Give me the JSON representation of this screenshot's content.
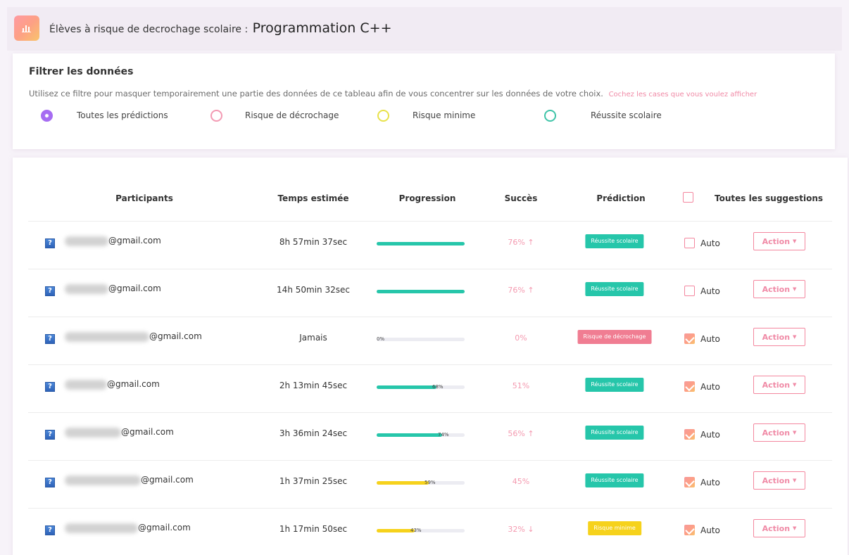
{
  "header": {
    "title_prefix": "Élèves à risque de decrochage scolaire :",
    "course": "Programmation C++",
    "icon": "chart-icon"
  },
  "filter": {
    "title": "Filtrer les données",
    "description": "Utilisez ce filtre pour masquer temporairement une partie des données de ce tableau afin de vous concentrer sur les données de votre choix.",
    "hint": "Cochez les cases que vous voulez afficher",
    "options": [
      {
        "label": "Toutes les prédictions",
        "selected": true,
        "color": "#a66cf2"
      },
      {
        "label": "Risque de décrochage",
        "selected": false,
        "color": "#f39ab3"
      },
      {
        "label": "Risque minime",
        "selected": false,
        "color": "#e8e24a"
      },
      {
        "label": "Réussite scolaire",
        "selected": false,
        "color": "#3fc4a8"
      }
    ]
  },
  "table": {
    "headers": {
      "participants": "Participants",
      "time": "Temps estimée",
      "progression": "Progression",
      "success": "Succès",
      "prediction": "Prédiction",
      "suggestions": "Toutes les suggestions"
    },
    "auto_label": "Auto",
    "action_label": "Action",
    "rows": [
      {
        "email_domain": "@gmail.com",
        "time": "8h 57min 37sec",
        "progress": 100,
        "progress_label": "",
        "success": "76%",
        "trend": "up",
        "prediction": "Réussite scolaire",
        "prediction_color": "#26c6aa",
        "auto_checked": false
      },
      {
        "email_domain": "@gmail.com",
        "time": "14h 50min 32sec",
        "progress": 100,
        "progress_label": "",
        "success": "76%",
        "trend": "up",
        "prediction": "Réussite scolaire",
        "prediction_color": "#26c6aa",
        "auto_checked": false
      },
      {
        "email_domain": "@gmail.com",
        "time": "Jamais",
        "progress": 0,
        "progress_label": "0%",
        "success": "0%",
        "trend": "",
        "prediction": "Risque de décrochage",
        "prediction_color": "#f07d92",
        "auto_checked": true
      },
      {
        "email_domain": "@gmail.com",
        "time": "2h 13min 45sec",
        "progress": 68,
        "progress_label": "68%",
        "success": "51%",
        "trend": "",
        "prediction": "Réussite scolaire",
        "prediction_color": "#26c6aa",
        "auto_checked": true
      },
      {
        "email_domain": "@gmail.com",
        "time": "3h 36min 24sec",
        "progress": 74,
        "progress_label": "74%",
        "success": "56%",
        "trend": "up",
        "prediction": "Réussite scolaire",
        "prediction_color": "#26c6aa",
        "auto_checked": true
      },
      {
        "email_domain": "@gmail.com",
        "time": "1h 37min 25sec",
        "progress": 59,
        "progress_label": "59%",
        "success": "45%",
        "trend": "",
        "prediction": "Réussite scolaire",
        "prediction_color": "#26c6aa",
        "auto_checked": true
      },
      {
        "email_domain": "@gmail.com",
        "time": "1h 17min 50sec",
        "progress": 43,
        "progress_label": "43%",
        "success": "32%",
        "trend": "down",
        "prediction": "Risque minime",
        "prediction_color": "#f6d21c",
        "auto_checked": true
      }
    ]
  },
  "colors": {
    "accent_pink": "#f4879f",
    "progress_high": "#26c6aa",
    "progress_low": "#f6d21c"
  }
}
